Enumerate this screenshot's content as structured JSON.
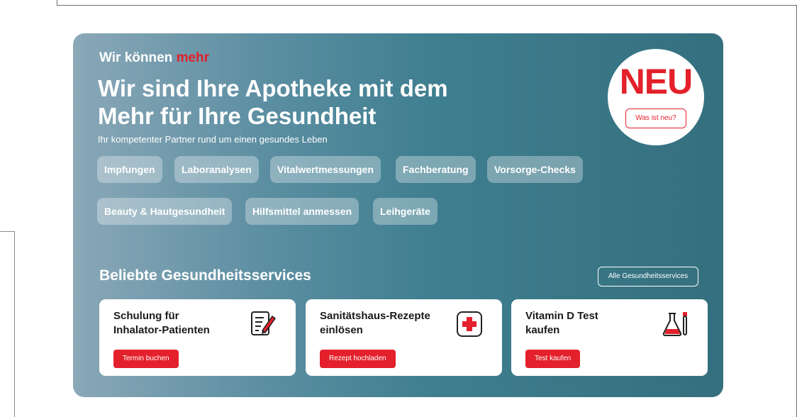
{
  "hero": {
    "eyebrow_prefix": "Wir können ",
    "eyebrow_accent": "mehr",
    "headline_line1": "Wir sind Ihre Apotheke mit dem",
    "headline_line2": "Mehr für Ihre Gesundheit",
    "subline": "Ihr kompetenter Partner rund um einen gesundes Leben",
    "chips": [
      "Impfungen",
      "Laboranalysen",
      "Vitalwertmessungen",
      "Fachberatung",
      "Vorsorge-Checks",
      "Beauty & Hautgesundheit",
      "Hilfsmittel anmessen",
      "Leihgeräte"
    ],
    "badge": {
      "title": "NEU",
      "button_label": "Was ist neu?"
    }
  },
  "services": {
    "title": "Beliebte Gesundheitsservices",
    "all_label": "Alle Gesundheitsservices",
    "cards": [
      {
        "title_line1": "Schulung für",
        "title_line2": "Inhalator-Patienten",
        "button_label": "Termin buchen",
        "icon": "document-pen-icon"
      },
      {
        "title_line1": "Sanitätshaus-Rezepte",
        "title_line2": "einlösen",
        "button_label": "Rezept hochladen",
        "icon": "medical-cross-icon"
      },
      {
        "title_line1": "Vitamin D Test",
        "title_line2": "kaufen",
        "button_label": "Test kaufen",
        "icon": "lab-flask-icon"
      }
    ]
  },
  "colors": {
    "accent_red": "#e3202b",
    "hero_gradient_start": "#8aa8b8",
    "hero_gradient_end": "#346f7e"
  }
}
